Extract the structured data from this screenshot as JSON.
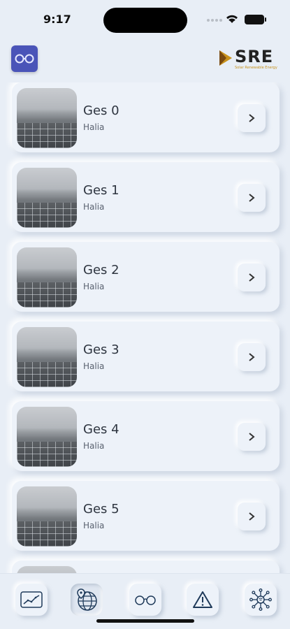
{
  "status_bar": {
    "time": "9:17"
  },
  "header": {
    "app_icon": "glasses-icon",
    "brand": {
      "text": "SRE",
      "tagline": "Solar Renewable Energy"
    }
  },
  "colors": {
    "background": "#e8eef6",
    "card": "#edf2f9",
    "app_icon": "#4a54b8",
    "brand_accent": "#c8921c"
  },
  "sites": [
    {
      "title": "Ges 0",
      "subtitle": "Halia"
    },
    {
      "title": "Ges 1",
      "subtitle": "Halia"
    },
    {
      "title": "Ges 2",
      "subtitle": "Halia"
    },
    {
      "title": "Ges 3",
      "subtitle": "Halia"
    },
    {
      "title": "Ges 4",
      "subtitle": "Halia"
    },
    {
      "title": "Ges 5",
      "subtitle": "Halia"
    },
    {
      "title": "",
      "subtitle": ""
    }
  ],
  "tabbar": [
    {
      "icon": "chart-line-icon",
      "active": false
    },
    {
      "icon": "globe-map-icon",
      "active": true
    },
    {
      "icon": "glasses-icon",
      "active": false
    },
    {
      "icon": "warning-icon",
      "active": false
    },
    {
      "icon": "network-icon",
      "active": false
    }
  ]
}
